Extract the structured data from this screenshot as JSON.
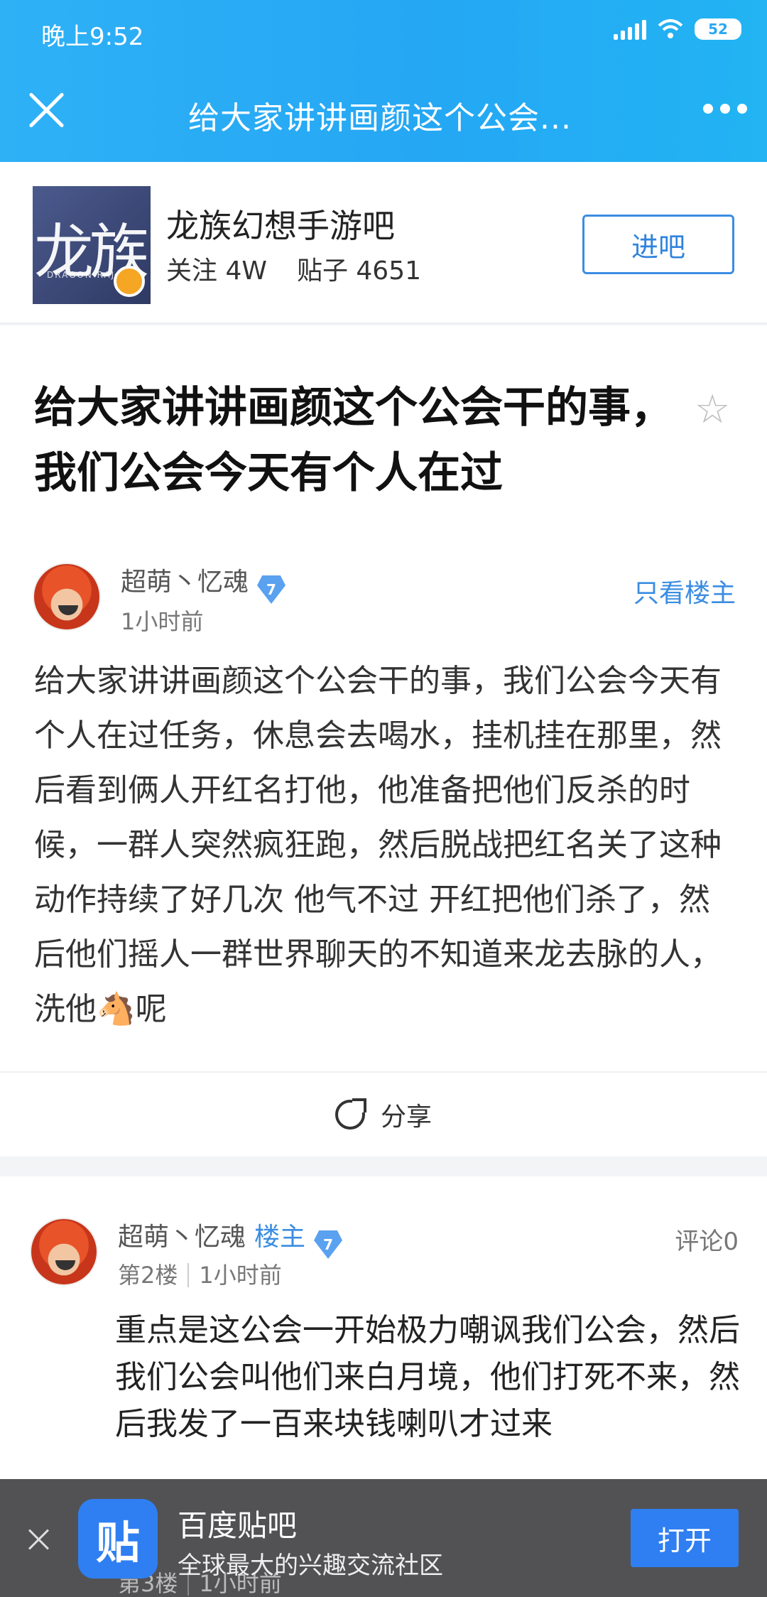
{
  "status": {
    "time": "晚上9:52",
    "battery": "52"
  },
  "header": {
    "title": "给大家讲讲画颜这个公会..."
  },
  "forum": {
    "name": "龙族幻想手游吧",
    "logo_text": "龙族",
    "logo_sub": "DRAGON RAJA",
    "followers": "关注 4W",
    "posts": "贴子 4651",
    "enter_label": "进吧"
  },
  "post": {
    "title": "给大家讲讲画颜这个公会干的事，我们公会今天有个人在过",
    "author": "超萌丶忆魂",
    "level": "7",
    "time": "1小时前",
    "only_owner_label": "只看楼主",
    "body": "给大家讲讲画颜这个公会干的事，我们公会今天有个人在过任务，休息会去喝水，挂机挂在那里，然后看到俩人开红名打他，他准备把他们反杀的时候，一群人突然疯狂跑，然后脱战把红名关了这种动作持续了好几次 他气不过 开红把他们杀了，然后他们摇人一群世界聊天的不知道来龙去脉的人，洗他🐴呢",
    "share_label": "分享"
  },
  "reply": {
    "author": "超萌丶忆魂",
    "owner_tag": "楼主",
    "level": "7",
    "comments": "评论0",
    "floor": "第2楼",
    "time": "1小时前",
    "body": "重点是这公会一开始极力嘲讽我们公会，然后我们公会叫他们来白月境，他们打死不来，然后我发了一百来块钱喇叭才过来"
  },
  "reply3": {
    "floor": "第3楼",
    "time": "1小时前"
  },
  "banner": {
    "logo_text": "贴",
    "name": "百度贴吧",
    "desc": "全球最大的兴趣交流社区",
    "open_label": "打开"
  }
}
